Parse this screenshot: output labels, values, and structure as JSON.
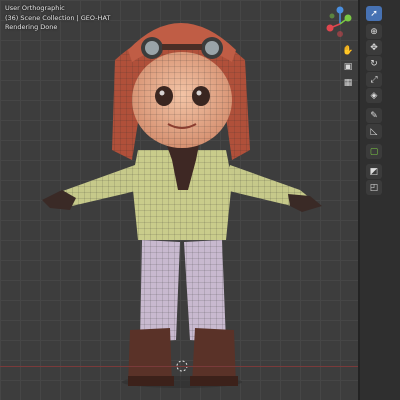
{
  "viewport": {
    "info_lines": [
      "User Orthographic",
      "(36) Scene Collection | GEO-HAT",
      "Rendering Done"
    ],
    "gizmo_axes": [
      "Z",
      "Y",
      "X"
    ],
    "colors": {
      "x_axis": "#e0464e",
      "y_axis": "#7ac943",
      "z_axis": "#4a8fe0"
    }
  },
  "nav_icons": [
    "hand-icon",
    "camera-icon",
    "perspective-grid-icon"
  ],
  "toolbar": {
    "tools": [
      {
        "name": "select-tool",
        "active": true
      },
      {
        "name": "cursor-tool",
        "active": false
      },
      {
        "name": "move-tool",
        "active": false
      },
      {
        "name": "rotate-tool",
        "active": false
      },
      {
        "name": "scale-tool",
        "active": false
      },
      {
        "name": "transform-tool",
        "active": false
      },
      {
        "name": "annotate-tool",
        "active": false
      },
      {
        "name": "measure-tool",
        "active": false
      },
      {
        "name": "add-cube-tool",
        "active": false
      },
      {
        "name": "extrude-tool",
        "active": false
      },
      {
        "name": "inset-tool",
        "active": false
      }
    ]
  }
}
